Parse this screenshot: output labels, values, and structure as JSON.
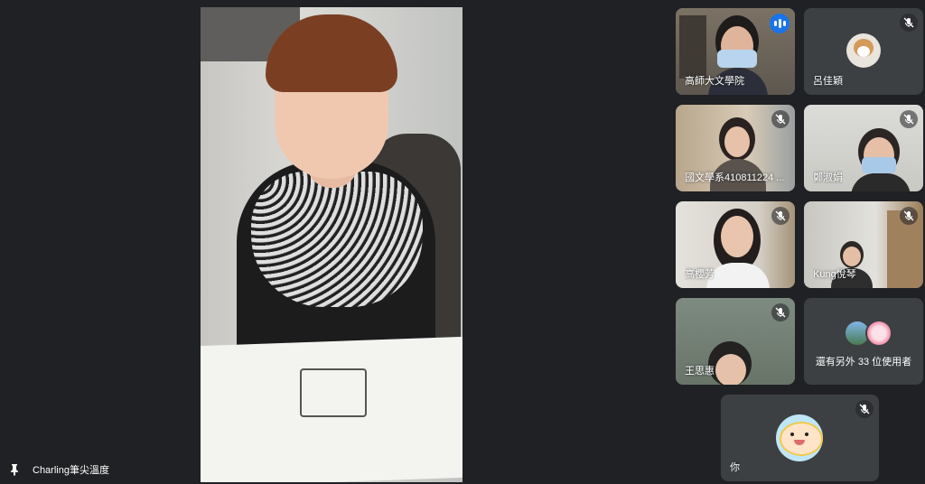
{
  "main_speaker": {
    "name": "Charling筆尖溫度"
  },
  "participants": [
    {
      "name": "高師大文學院",
      "speaking": true,
      "muted": false
    },
    {
      "name": "呂佳穎",
      "speaking": false,
      "muted": true
    },
    {
      "name": "國文學系410811224 ...",
      "speaking": false,
      "muted": true
    },
    {
      "name": "鄭淑娟",
      "speaking": false,
      "muted": true
    },
    {
      "name": "高櫻芳",
      "speaking": false,
      "muted": true
    },
    {
      "name": "Kung悅琴",
      "speaking": false,
      "muted": true
    },
    {
      "name": "王思惠",
      "speaking": false,
      "muted": true
    }
  ],
  "others": {
    "label": "還有另外 33 位使用者"
  },
  "self": {
    "name": "你",
    "muted": true
  },
  "colors": {
    "background": "#202124",
    "tile": "#3c4043",
    "active_outline": "#8ab4f8",
    "speaking_badge": "#1a73e8"
  }
}
